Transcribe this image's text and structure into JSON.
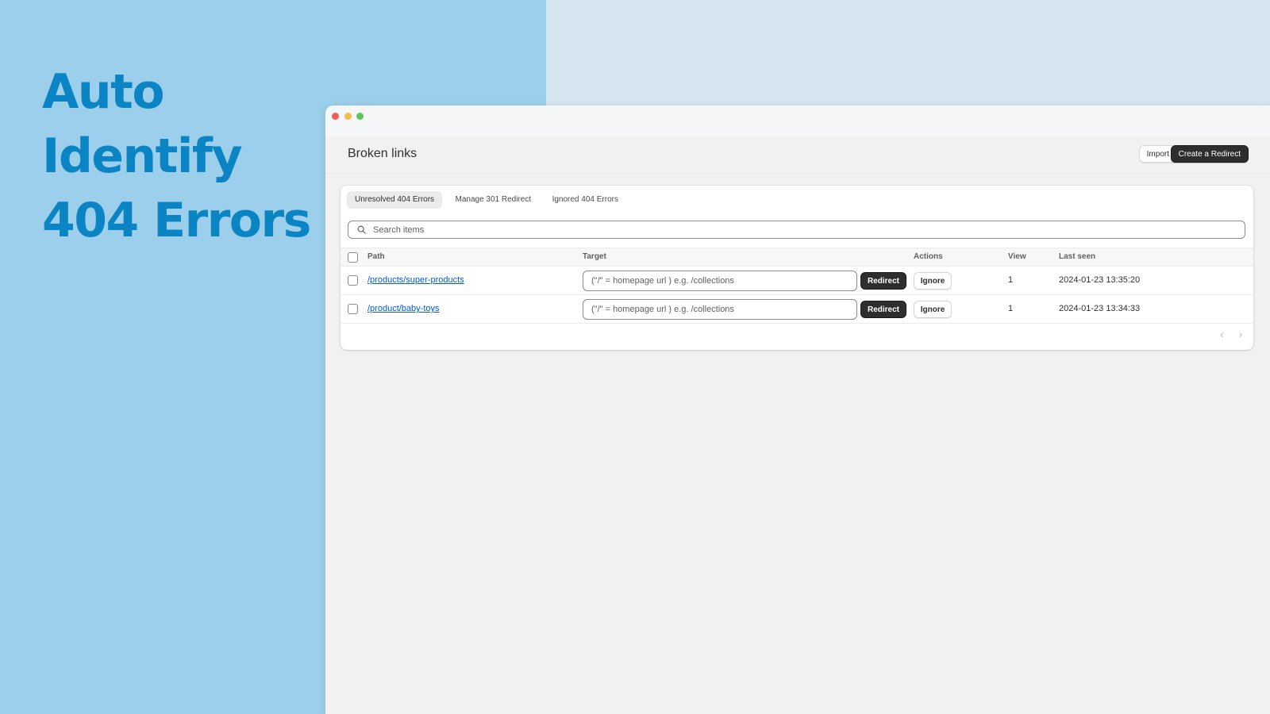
{
  "hero": {
    "line1": "Auto",
    "line2": "Identify",
    "line3": "404 Errors"
  },
  "window": {
    "title": "Broken links",
    "import_label": "Import",
    "create_label": "Create a Redirect"
  },
  "tabs": [
    {
      "label": "Unresolved 404 Errors",
      "active": true
    },
    {
      "label": "Manage 301 Redirect",
      "active": false
    },
    {
      "label": "Ignored 404 Errors",
      "active": false
    }
  ],
  "search": {
    "placeholder": "Search items"
  },
  "table": {
    "columns": {
      "path": "Path",
      "target": "Target",
      "actions": "Actions",
      "view": "View",
      "last_seen": "Last seen"
    },
    "rows": [
      {
        "path": "/products/super-products",
        "target_placeholder": "(\"/\" = homepage url ) e.g. /collections",
        "redirect_label": "Redirect",
        "ignore_label": "Ignore",
        "view": "1",
        "last_seen": "2024-01-23 13:35:20"
      },
      {
        "path": "/product/baby-toys",
        "target_placeholder": "(\"/\" = homepage url ) e.g. /collections",
        "redirect_label": "Redirect",
        "ignore_label": "Ignore",
        "view": "1",
        "last_seen": "2024-01-23 13:34:33"
      }
    ]
  },
  "pager": {
    "prev_icon": "chevron-left-icon",
    "next_icon": "chevron-right-icon"
  },
  "colors": {
    "hero_text": "#0b84c3",
    "left_panel": "#9ccfeb",
    "right_panel": "#d4e5f0",
    "link": "#005bd3",
    "primary_button": "#2e2e2e"
  }
}
